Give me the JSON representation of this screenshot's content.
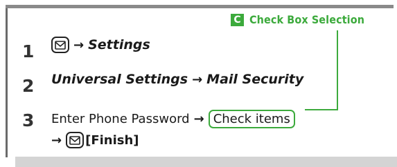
{
  "hint": {
    "badge": "C",
    "text": "Check Box Selection"
  },
  "steps": [
    {
      "number": "1",
      "text": "Settings"
    },
    {
      "number": "2",
      "part_a": "Universal Settings",
      "part_b": "Mail Security"
    },
    {
      "number": "3",
      "prefix": "Enter Phone Password",
      "highlight": "Check items",
      "finish": "[Finish]"
    }
  ],
  "glyphs": {
    "arrow": "→"
  },
  "colors": {
    "accent": "#3caa3c",
    "frame": "#6a6a6a",
    "footer": "#d4d4d4"
  },
  "icons": {
    "mail_key": "mail-key-icon"
  }
}
